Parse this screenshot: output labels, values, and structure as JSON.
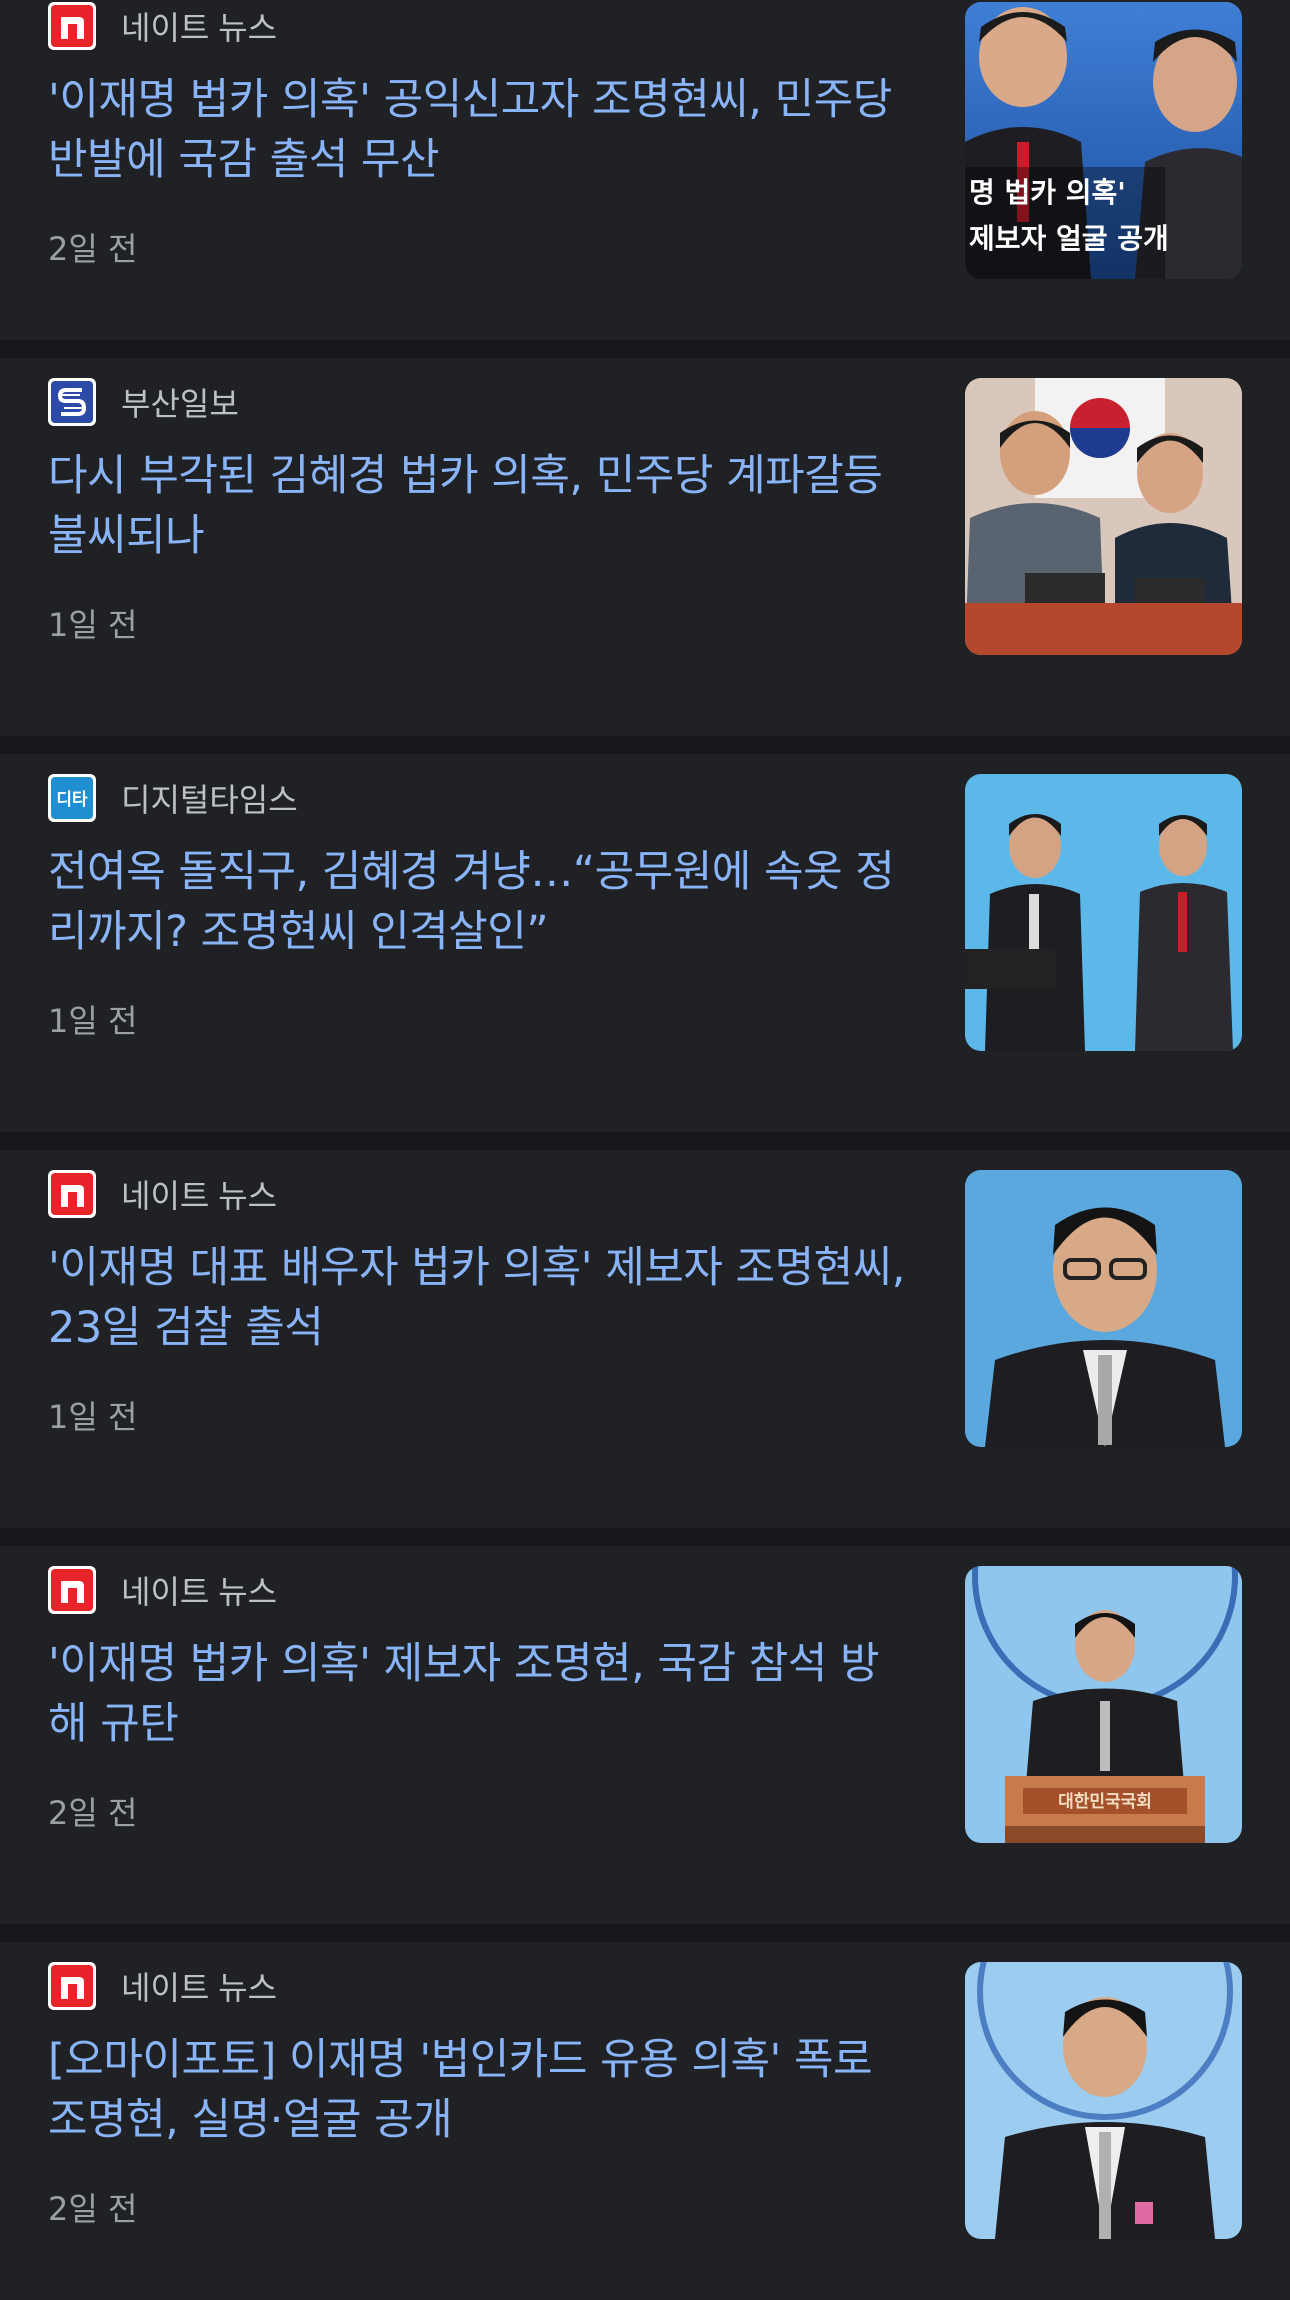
{
  "articles": [
    {
      "source": "네이트 뉴스",
      "logo": "nate-n-logo",
      "title": "'이재명 법카 의혹' 공익신고자 조명현씨, 민주당 반발에 국감 출석 무산",
      "time": "2일 전",
      "thumb_caption_1": "명 법카 의혹'",
      "thumb_caption_2": "제보자 얼굴 공개"
    },
    {
      "source": "부산일보",
      "logo": "busan-ilbo-logo",
      "title": "다시 부각된 김혜경 법카 의혹, 민주당 계파갈등 불씨되나",
      "time": "1일 전"
    },
    {
      "source": "디지털타임스",
      "logo": "digital-times-logo",
      "logo_text": "디타",
      "title": "전여옥 돌직구, 김혜경 겨냥…“공무원에 속옷 정리까지? 조명현씨 인격살인”",
      "time": "1일 전"
    },
    {
      "source": "네이트 뉴스",
      "logo": "nate-n-logo",
      "title": "'이재명 대표 배우자 법카 의혹' 제보자 조명현씨, 23일 검찰 출석",
      "time": "1일 전"
    },
    {
      "source": "네이트 뉴스",
      "logo": "nate-n-logo",
      "title": "'이재명 법카 의혹' 제보자 조명현, 국감 참석 방해 규탄",
      "time": "2일 전",
      "thumb_sign": "대한민국국회"
    },
    {
      "source": "네이트 뉴스",
      "logo": "nate-n-logo",
      "title": "[오마이포토] 이재명 '법인카드 유용 의혹' 폭로 조명현, 실명·얼굴 공개",
      "time": "2일 전"
    }
  ],
  "colors": {
    "background": "#202124",
    "separator": "#17181b",
    "title": "#8ab4f8",
    "source": "#bdc1c6",
    "time": "#9aa0a6",
    "nate_red": "#e8232a"
  }
}
